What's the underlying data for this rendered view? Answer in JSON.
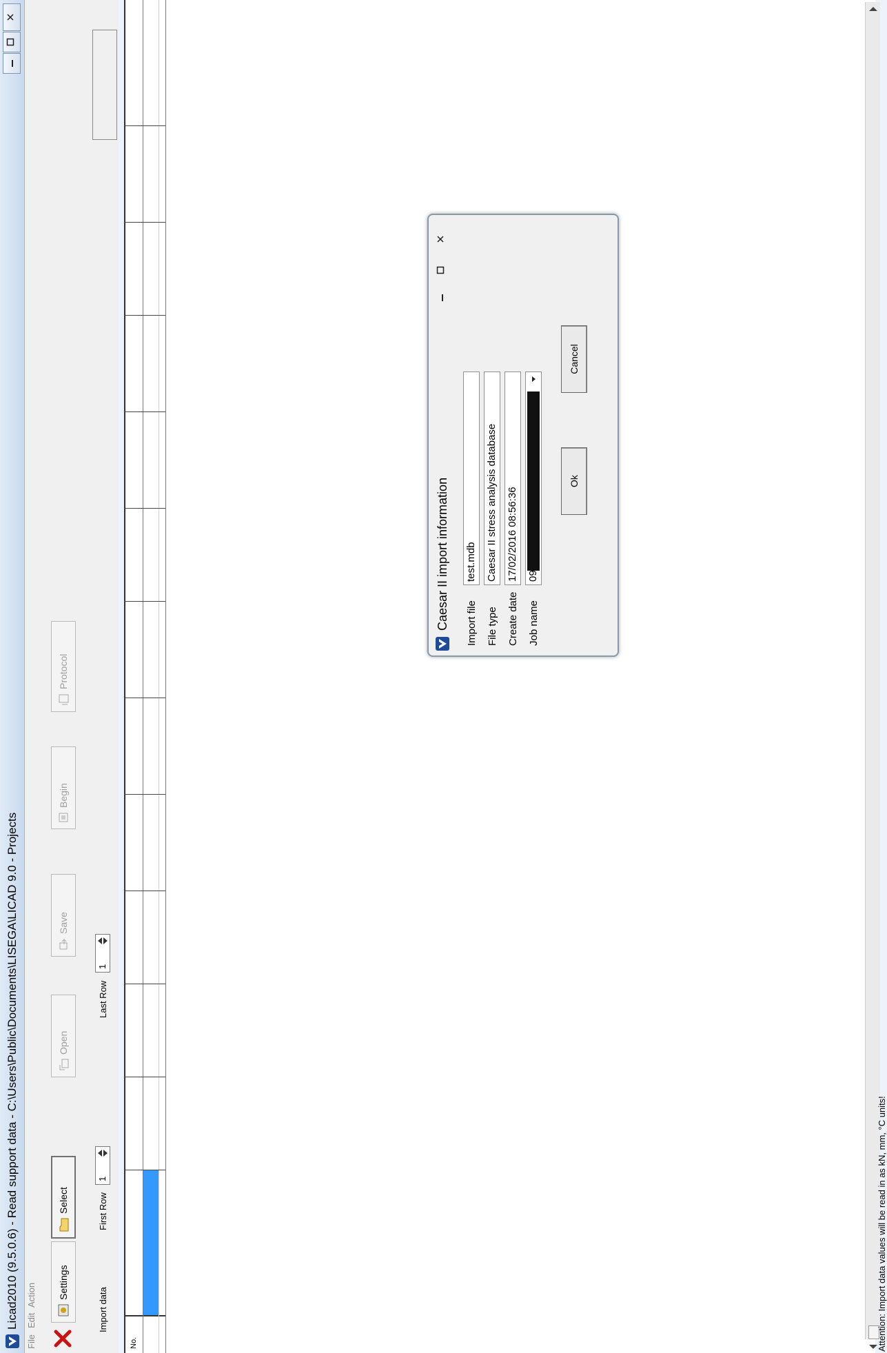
{
  "window": {
    "title": "Licad2010 (9.5.0.6) - Read support data - C:\\Users\\Public\\Documents\\LISEGA\\LICAD 9.0 - Projects"
  },
  "menu": {
    "items": [
      "File",
      "Edit",
      "Action"
    ]
  },
  "toolbar": {
    "settings_label": "Settings",
    "select_label": "Select",
    "open_label": "Open",
    "save_label": "Save",
    "begin_label": "Begin",
    "protocol_label": "Protocol"
  },
  "import_row": {
    "import_data_label": "Import data",
    "first_row_label": "First Row",
    "first_row_value": "1",
    "last_row_label": "Last Row",
    "last_row_value": "1"
  },
  "grid": {
    "col_no": "No."
  },
  "status": {
    "text": "Attention: Import data values will be read in as kN, mm, °C units!"
  },
  "dialog": {
    "title": "Caesar II import information",
    "import_file_label": "Import file",
    "import_file_value": "test.mdb",
    "file_type_label": "File type",
    "file_type_value": "Caesar II stress analysis database",
    "create_date_label": "Create date",
    "create_date_value": "17/02/2016 08:56:36",
    "job_name_label": "Job name",
    "job_name_value": "09",
    "ok_label": "Ok",
    "cancel_label": "Cancel"
  },
  "colors": {
    "selection": "#3399ff",
    "close_red": "#cc1111"
  }
}
